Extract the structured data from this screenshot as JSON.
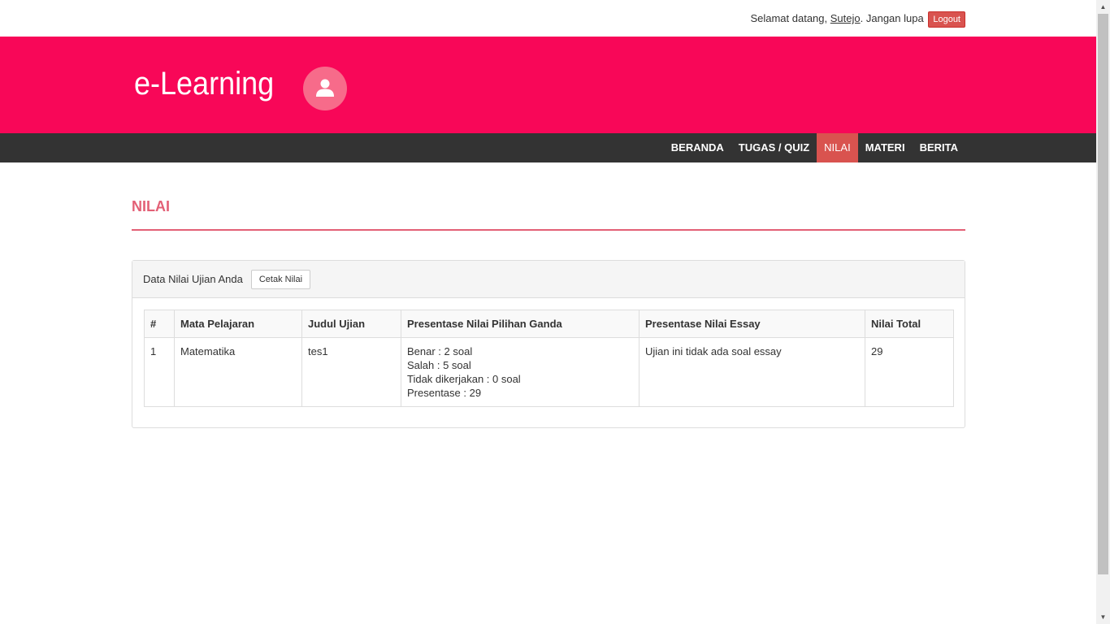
{
  "header": {
    "welcome_prefix": "Selamat datang,",
    "username": "Sutejo",
    "welcome_suffix": ". Jangan lupa",
    "logout_label": "Logout"
  },
  "brand": {
    "title": "e-Learning",
    "avatar_icon": "user-icon",
    "banner_color": "#f80758"
  },
  "nav": {
    "items": [
      {
        "label": "BERANDA"
      },
      {
        "label": "TUGAS / QUIZ"
      },
      {
        "label": "NILAI",
        "active": true
      },
      {
        "label": "MATERI"
      },
      {
        "label": "BERITA"
      }
    ]
  },
  "page": {
    "title": "NILAI"
  },
  "panel": {
    "heading": "Data Nilai Ujian Anda",
    "print_label": "Cetak Nilai"
  },
  "table": {
    "columns": [
      "#",
      "Mata Pelajaran",
      "Judul Ujian",
      "Presentase Nilai Pilihan Ganda",
      "Presentase Nilai Essay",
      "Nilai Total"
    ],
    "rows": [
      {
        "no": "1",
        "subject": "Matematika",
        "exam": "tes1",
        "mc_lines": [
          "Benar : 2 soal",
          "Salah : 5 soal",
          "Tidak dikerjakan : 0 soal",
          "Presentase : 29"
        ],
        "essay": "Ujian ini tidak ada soal essay",
        "total": "29"
      }
    ]
  }
}
